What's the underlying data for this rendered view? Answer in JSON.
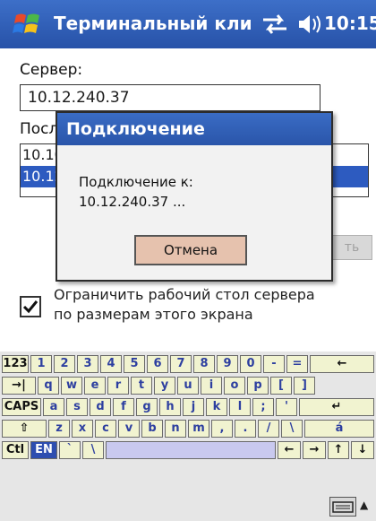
{
  "titlebar": {
    "title": "Терминальный кли",
    "time": "10:15",
    "start_icon": "windows-flag-icon",
    "connectivity_icon": "connectivity-arrows-icon",
    "volume_icon": "speaker-icon"
  },
  "form": {
    "server_label": "Сервер:",
    "server_value": "10.12.240.37",
    "recent_label": "Посл",
    "recent_items": [
      "10.10",
      "10.12"
    ],
    "connect_button_partial": "ть",
    "checkbox_checked": true,
    "checkbox_text_line1": "Ограничить рабочий стол сервера",
    "checkbox_text_line2": "по размерам этого экрана"
  },
  "dialog": {
    "title": "Подключение",
    "message_line1": "Подключение к:",
    "message_line2": "10.12.240.37 ...",
    "cancel_label": "Отмена"
  },
  "keyboard": {
    "row1": [
      "123",
      "1",
      "2",
      "3",
      "4",
      "5",
      "6",
      "7",
      "8",
      "9",
      "0",
      "-",
      "=",
      "←"
    ],
    "row2": [
      "→|",
      "q",
      "w",
      "e",
      "r",
      "t",
      "y",
      "u",
      "i",
      "o",
      "p",
      "[",
      "]"
    ],
    "row3": [
      "CAPS",
      "a",
      "s",
      "d",
      "f",
      "g",
      "h",
      "j",
      "k",
      "l",
      ";",
      "'",
      "↵"
    ],
    "row4": [
      "⇧",
      "z",
      "x",
      "c",
      "v",
      "b",
      "n",
      "m",
      ",",
      ".",
      "/",
      "\\",
      "á"
    ],
    "row5": [
      "Ctl",
      "EN",
      "`",
      "\\",
      "",
      "←",
      "→",
      "↑",
      "↓"
    ]
  }
}
